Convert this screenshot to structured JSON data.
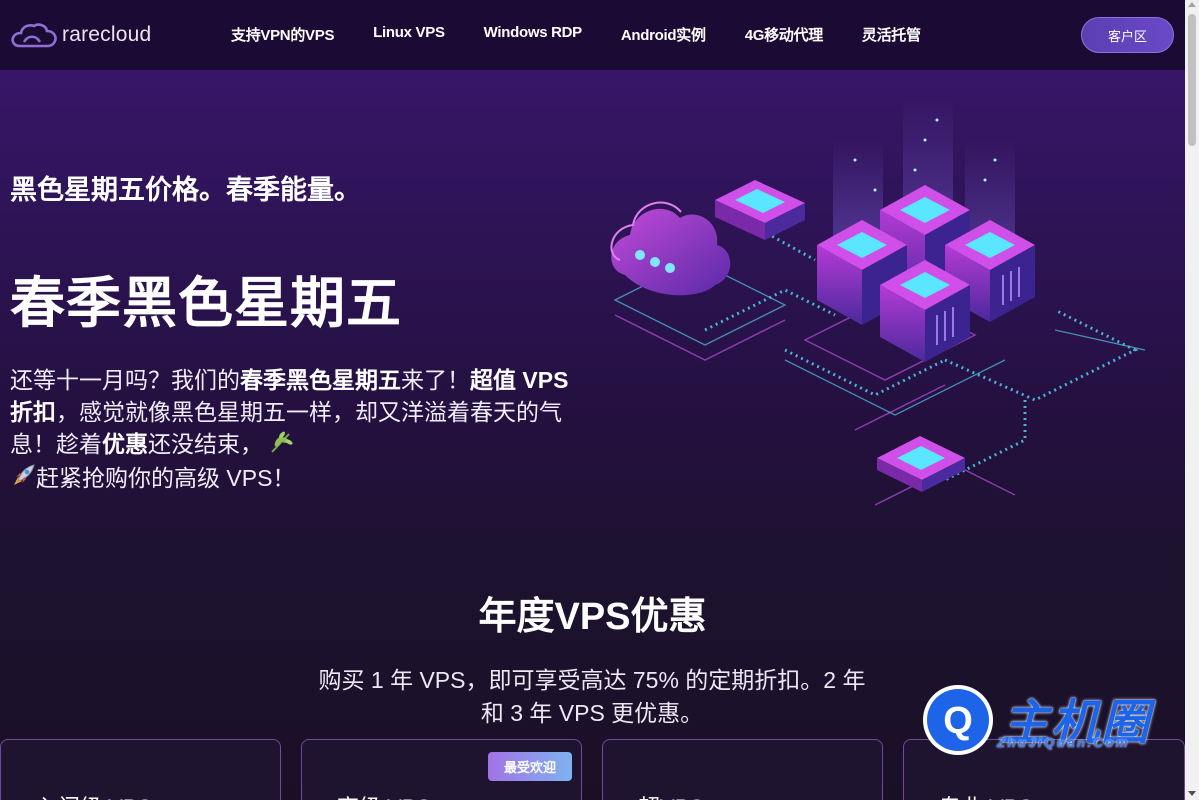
{
  "header": {
    "logo_text": "rarecloud",
    "nav": [
      {
        "label": "支持VPN的VPS"
      },
      {
        "label": "Linux VPS"
      },
      {
        "label": "Windows RDP"
      },
      {
        "label": "Android实例"
      },
      {
        "label": "4G移动代理"
      },
      {
        "label": "灵活托管"
      }
    ],
    "client_button": "客户区"
  },
  "hero": {
    "subtitle": "黑色星期五价格。春季能量。",
    "title": "春季黑色星期五",
    "desc": {
      "p1": "还等十一月吗？我们的",
      "b1": "春季黑色星期五",
      "p2": "来了！",
      "b2": "超值 VPS 折扣",
      "p3": "，感觉就像黑色星期五一样，却又洋溢着春天的气息！趁着",
      "b3": "优惠",
      "p4": "还没结束，",
      "e1": "🌿",
      "e2": "🚀",
      "p5": "赶紧抢购你的高级 VPS！"
    }
  },
  "annual": {
    "title": "年度VPS优惠",
    "desc": "购买 1 年 VPS，即可享受高达 75% 的定期折扣。2 年和 3 年 VPS 更优惠。"
  },
  "cards": [
    {
      "title": "入门级 VPS",
      "badge": ""
    },
    {
      "title": "高级 VPS",
      "badge": "最受欢迎"
    },
    {
      "title": "超VPS",
      "badge": ""
    },
    {
      "title": "专业 VPS",
      "badge": ""
    }
  ],
  "watermark": {
    "text": "主机圈",
    "letter": "Q",
    "sub": "ZhuJiQuan.Com"
  },
  "colors": {
    "header_bg": "#1b0a33",
    "hero_bg": "#3c1670",
    "accent": "#6a49c7",
    "watermark_blue": "#1e64e8"
  }
}
